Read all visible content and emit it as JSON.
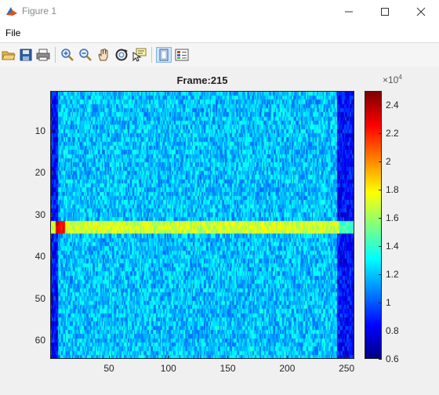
{
  "window": {
    "title": "Figure 1"
  },
  "menu": {
    "file": "File"
  },
  "toolbar": {
    "icons": [
      "open-folder-icon",
      "save-icon",
      "print-icon",
      "zoom-in-icon",
      "zoom-out-icon",
      "pan-icon",
      "rotate-3d-icon",
      "data-cursor-icon",
      "link-plot-icon",
      "insert-colorbar-icon"
    ]
  },
  "plot": {
    "title": "Frame:215",
    "colorbar_exponent_base": "×10",
    "colorbar_exponent_power": "4"
  },
  "chart_data": {
    "type": "heatmap",
    "title": "Frame:215",
    "x_ticks": [
      50,
      100,
      150,
      200,
      250
    ],
    "y_ticks": [
      10,
      20,
      30,
      40,
      50,
      60
    ],
    "xlim": [
      0.5,
      256.5
    ],
    "ylim": [
      0.5,
      64.5
    ],
    "colormap": "jet",
    "colorbar_ticks": [
      0.6,
      0.8,
      1,
      1.2,
      1.4,
      1.6,
      1.8,
      2,
      2.2,
      2.4
    ],
    "colorbar_range": [
      0.6,
      2.5
    ],
    "colorbar_multiplier": "x10^4",
    "features": {
      "background_level": 1.2,
      "edge_columns_level": 0.85,
      "bright_band_rows": [
        32,
        33,
        34
      ],
      "bright_band_level": 1.7,
      "hotspot_column_range": [
        5,
        12
      ],
      "hotspot_level": 2.3
    }
  }
}
